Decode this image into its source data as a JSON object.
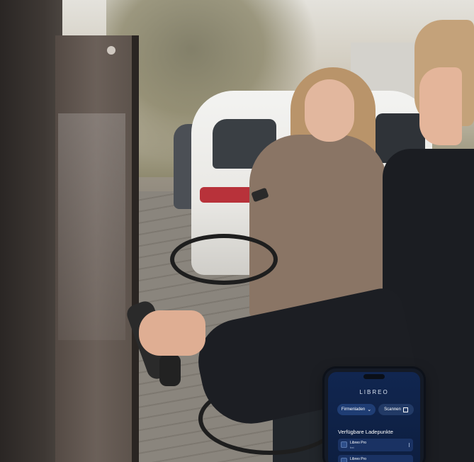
{
  "app": {
    "brand": "LIBREO",
    "buttons": {
      "company_charge": "Firmenladen",
      "scan": "Scannen"
    },
    "section_title": "Verfügbare Ladepunkte",
    "charge_points": [
      {
        "name": "Libreo Pro",
        "status": "frei"
      },
      {
        "name": "Libreo Pro",
        "status": ""
      }
    ]
  },
  "icons": {
    "company_charge": "chevron-down-icon",
    "scan": "qr-scan-icon",
    "charge_point": "charger-icon"
  }
}
